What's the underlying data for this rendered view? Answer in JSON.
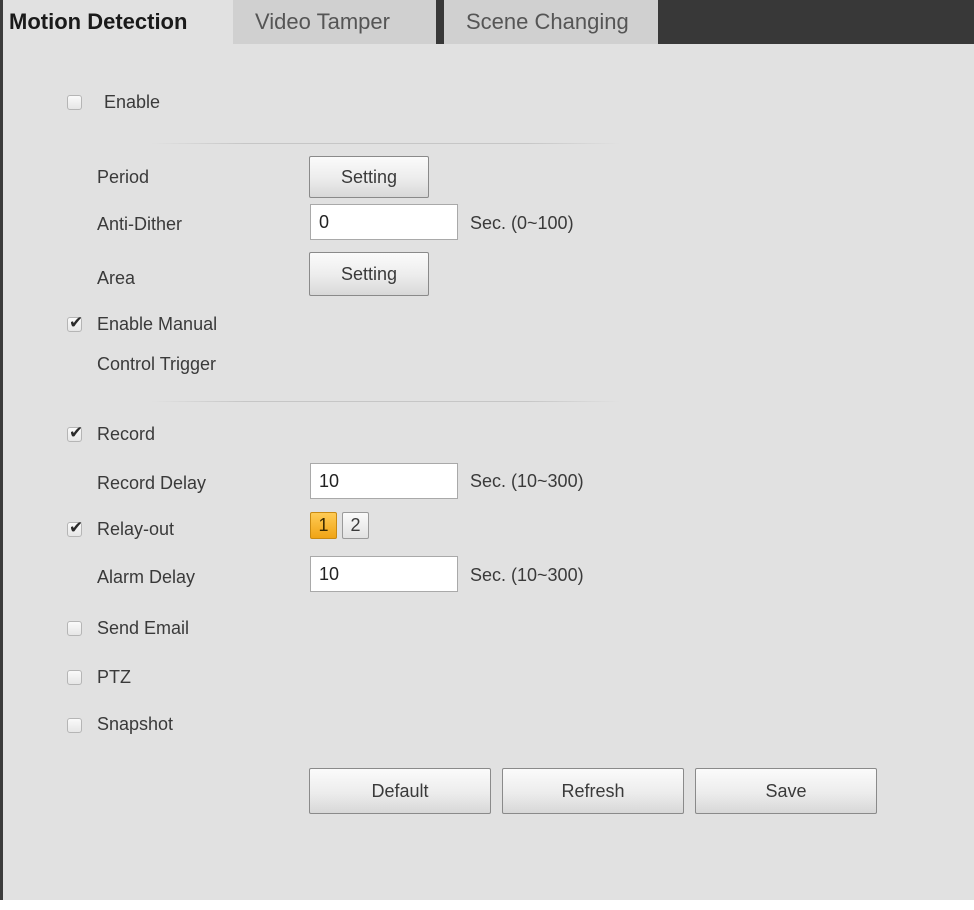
{
  "tabs": [
    {
      "label": "Motion Detection",
      "active": true
    },
    {
      "label": "Video Tamper",
      "active": false
    },
    {
      "label": "Scene Changing",
      "active": false
    }
  ],
  "enable": {
    "label": "Enable",
    "checked": false
  },
  "period": {
    "label": "Period",
    "button": "Setting"
  },
  "anti_dither": {
    "label": "Anti-Dither",
    "value": "0",
    "unit": "Sec. (0~100)"
  },
  "area": {
    "label": "Area",
    "button": "Setting"
  },
  "manual_trigger": {
    "label_line1": "Enable Manual",
    "label_line2": "Control Trigger",
    "checked": true
  },
  "record": {
    "label": "Record",
    "checked": true
  },
  "record_delay": {
    "label": "Record Delay",
    "value": "10",
    "unit": "Sec. (10~300)"
  },
  "relay_out": {
    "label": "Relay-out",
    "checked": true,
    "channels": [
      {
        "label": "1",
        "selected": true
      },
      {
        "label": "2",
        "selected": false
      }
    ]
  },
  "alarm_delay": {
    "label": "Alarm Delay",
    "value": "10",
    "unit": "Sec. (10~300)"
  },
  "send_email": {
    "label": "Send Email",
    "checked": false
  },
  "ptz": {
    "label": "PTZ",
    "checked": false
  },
  "snapshot": {
    "label": "Snapshot",
    "checked": false
  },
  "actions": {
    "default_label": "Default",
    "refresh_label": "Refresh",
    "save_label": "Save"
  },
  "colors": {
    "tab_bar": "#383838",
    "panel_bg": "#e1e1e1",
    "relay_selected": "#f0a415"
  }
}
